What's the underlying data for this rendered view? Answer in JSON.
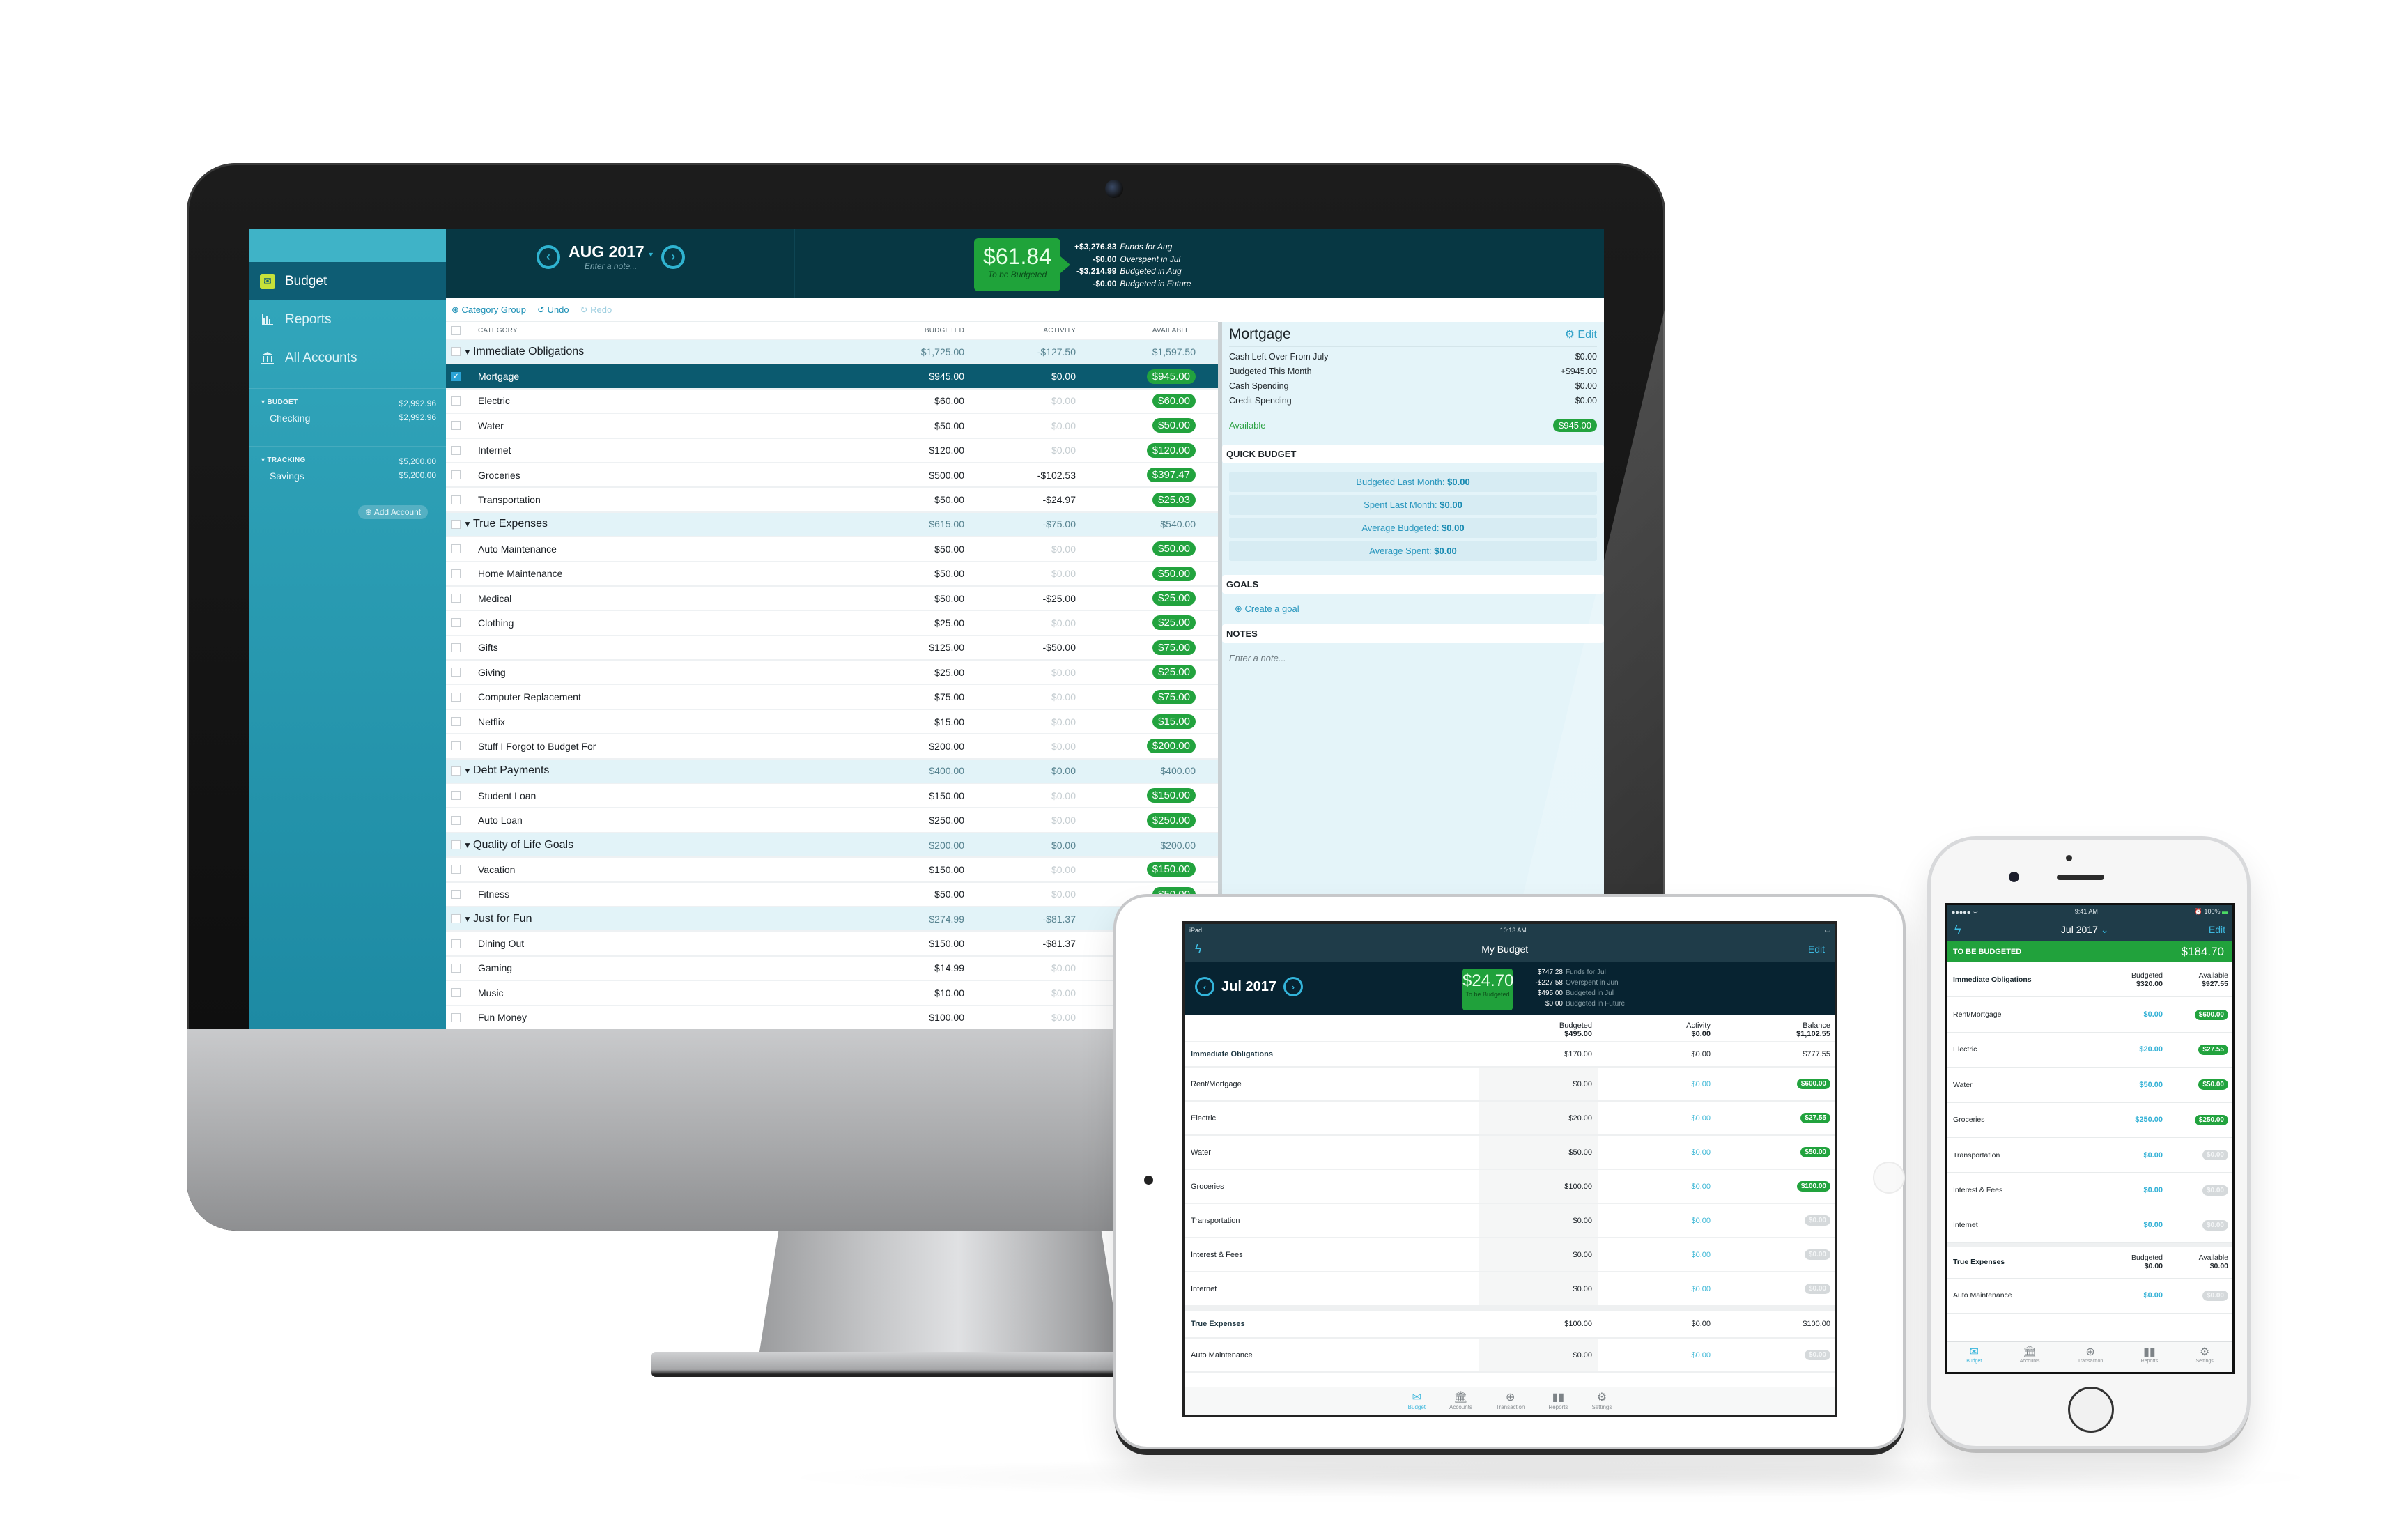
{
  "desktop": {
    "sidebar": {
      "nav": [
        {
          "label": "Budget",
          "icon": "envelope-icon",
          "active": true
        },
        {
          "label": "Reports",
          "icon": "bar-chart-icon",
          "active": false
        },
        {
          "label": "All Accounts",
          "icon": "bank-icon",
          "active": false
        }
      ],
      "account_groups": [
        {
          "name": "BUDGET",
          "total": "$2,992.96",
          "accounts": [
            {
              "name": "Checking",
              "balance": "$2,992.96"
            }
          ]
        },
        {
          "name": "TRACKING",
          "total": "$5,200.00",
          "accounts": [
            {
              "name": "Savings",
              "balance": "$5,200.00"
            }
          ]
        }
      ],
      "add_account_label": "Add Account"
    },
    "header": {
      "month": "AUG 2017",
      "note_placeholder": "Enter a note...",
      "to_be_budgeted": {
        "amount": "$61.84",
        "label": "To be Budgeted"
      },
      "funds_breakdown": [
        {
          "amount": "+$3,276.83",
          "label": "Funds for Aug"
        },
        {
          "amount": "-$0.00",
          "label": "Overspent in Jul"
        },
        {
          "amount": "-$3,214.99",
          "label": "Budgeted in Aug"
        },
        {
          "amount": "-$0.00",
          "label": "Budgeted in Future"
        }
      ]
    },
    "toolbar": {
      "category_group": "Category Group",
      "undo": "Undo",
      "redo": "Redo"
    },
    "table": {
      "columns": [
        "CATEGORY",
        "BUDGETED",
        "ACTIVITY",
        "AVAILABLE"
      ],
      "rows": [
        {
          "type": "group",
          "name": "Immediate Obligations",
          "budgeted": "$1,725.00",
          "activity": "-$127.50",
          "available": "$1,597.50"
        },
        {
          "type": "item",
          "name": "Mortgage",
          "budgeted": "$945.00",
          "activity": "$0.00",
          "available": "$945.00",
          "selected": true
        },
        {
          "type": "item",
          "name": "Electric",
          "budgeted": "$60.00",
          "activity": "$0.00",
          "available": "$60.00"
        },
        {
          "type": "item",
          "name": "Water",
          "budgeted": "$50.00",
          "activity": "$0.00",
          "available": "$50.00"
        },
        {
          "type": "item",
          "name": "Internet",
          "budgeted": "$120.00",
          "activity": "$0.00",
          "available": "$120.00"
        },
        {
          "type": "item",
          "name": "Groceries",
          "budgeted": "$500.00",
          "activity": "-$102.53",
          "available": "$397.47"
        },
        {
          "type": "item",
          "name": "Transportation",
          "budgeted": "$50.00",
          "activity": "-$24.97",
          "available": "$25.03"
        },
        {
          "type": "group",
          "name": "True Expenses",
          "budgeted": "$615.00",
          "activity": "-$75.00",
          "available": "$540.00"
        },
        {
          "type": "item",
          "name": "Auto Maintenance",
          "budgeted": "$50.00",
          "activity": "$0.00",
          "available": "$50.00"
        },
        {
          "type": "item",
          "name": "Home Maintenance",
          "budgeted": "$50.00",
          "activity": "$0.00",
          "available": "$50.00"
        },
        {
          "type": "item",
          "name": "Medical",
          "budgeted": "$50.00",
          "activity": "-$25.00",
          "available": "$25.00"
        },
        {
          "type": "item",
          "name": "Clothing",
          "budgeted": "$25.00",
          "activity": "$0.00",
          "available": "$25.00"
        },
        {
          "type": "item",
          "name": "Gifts",
          "budgeted": "$125.00",
          "activity": "-$50.00",
          "available": "$75.00"
        },
        {
          "type": "item",
          "name": "Giving",
          "budgeted": "$25.00",
          "activity": "$0.00",
          "available": "$25.00"
        },
        {
          "type": "item",
          "name": "Computer Replacement",
          "budgeted": "$75.00",
          "activity": "$0.00",
          "available": "$75.00"
        },
        {
          "type": "item",
          "name": "Netflix",
          "budgeted": "$15.00",
          "activity": "$0.00",
          "available": "$15.00"
        },
        {
          "type": "item",
          "name": "Stuff I Forgot to Budget For",
          "budgeted": "$200.00",
          "activity": "$0.00",
          "available": "$200.00"
        },
        {
          "type": "group",
          "name": "Debt Payments",
          "budgeted": "$400.00",
          "activity": "$0.00",
          "available": "$400.00"
        },
        {
          "type": "item",
          "name": "Student Loan",
          "budgeted": "$150.00",
          "activity": "$0.00",
          "available": "$150.00"
        },
        {
          "type": "item",
          "name": "Auto Loan",
          "budgeted": "$250.00",
          "activity": "$0.00",
          "available": "$250.00"
        },
        {
          "type": "group",
          "name": "Quality of Life Goals",
          "budgeted": "$200.00",
          "activity": "$0.00",
          "available": "$200.00"
        },
        {
          "type": "item",
          "name": "Vacation",
          "budgeted": "$150.00",
          "activity": "$0.00",
          "available": "$150.00"
        },
        {
          "type": "item",
          "name": "Fitness",
          "budgeted": "$50.00",
          "activity": "$0.00",
          "available": "$50.00"
        },
        {
          "type": "group",
          "name": "Just for Fun",
          "budgeted": "$274.99",
          "activity": "-$81.37",
          "available": ""
        },
        {
          "type": "item",
          "name": "Dining Out",
          "budgeted": "$150.00",
          "activity": "-$81.37",
          "available": ""
        },
        {
          "type": "item",
          "name": "Gaming",
          "budgeted": "$14.99",
          "activity": "$0.00",
          "available": ""
        },
        {
          "type": "item",
          "name": "Music",
          "budgeted": "$10.00",
          "activity": "$0.00",
          "available": ""
        },
        {
          "type": "item",
          "name": "Fun Money",
          "budgeted": "$100.00",
          "activity": "$0.00",
          "available": ""
        }
      ]
    },
    "inspector": {
      "title": "Mortgage",
      "edit_label": "Edit",
      "details": [
        {
          "label": "Cash Left Over From July",
          "value": "$0.00"
        },
        {
          "label": "Budgeted This Month",
          "value": "+$945.00"
        },
        {
          "label": "Cash Spending",
          "value": "$0.00"
        },
        {
          "label": "Credit Spending",
          "value": "$0.00"
        }
      ],
      "available_label": "Available",
      "available_value": "$945.00",
      "quick_budget_title": "QUICK BUDGET",
      "quick_budget": [
        {
          "label": "Budgeted Last Month:",
          "value": "$0.00"
        },
        {
          "label": "Spent Last Month:",
          "value": "$0.00"
        },
        {
          "label": "Average Budgeted:",
          "value": "$0.00"
        },
        {
          "label": "Average Spent:",
          "value": "$0.00"
        }
      ],
      "goals_title": "GOALS",
      "create_goal_label": "Create a goal",
      "notes_title": "NOTES",
      "notes_placeholder": "Enter a note..."
    }
  },
  "tablet": {
    "status": {
      "device": "iPad",
      "time": "10:13 AM"
    },
    "nav_title": "My Budget",
    "edit_label": "Edit",
    "month": "Jul 2017",
    "to_be_budgeted": {
      "amount": "$24.70",
      "label": "To be Budgeted"
    },
    "funds_breakdown": [
      {
        "amount": "$747.28",
        "label": "Funds for Jul"
      },
      {
        "amount": "-$227.58",
        "label": "Overspent in Jun"
      },
      {
        "amount": "$495.00",
        "label": "Budgeted in Jul"
      },
      {
        "amount": "$0.00",
        "label": "Budgeted in Future"
      }
    ],
    "totals": {
      "budgeted_label": "Budgeted",
      "budgeted": "$495.00",
      "activity_label": "Activity",
      "activity": "$0.00",
      "balance_label": "Balance",
      "balance": "$1,102.55"
    },
    "rows": [
      {
        "type": "group",
        "name": "Immediate Obligations",
        "budgeted": "$170.00",
        "activity": "$0.00",
        "balance": "$777.55"
      },
      {
        "type": "item",
        "name": "Rent/Mortgage",
        "budgeted": "$0.00",
        "activity": "$0.00",
        "balance": "$600.00",
        "status": "positive"
      },
      {
        "type": "item",
        "name": "Electric",
        "budgeted": "$20.00",
        "activity": "$0.00",
        "balance": "$27.55",
        "status": "positive"
      },
      {
        "type": "item",
        "name": "Water",
        "budgeted": "$50.00",
        "activity": "$0.00",
        "balance": "$50.00",
        "status": "positive"
      },
      {
        "type": "item",
        "name": "Groceries",
        "budgeted": "$100.00",
        "activity": "$0.00",
        "balance": "$100.00",
        "status": "positive"
      },
      {
        "type": "item",
        "name": "Transportation",
        "budgeted": "$0.00",
        "activity": "$0.00",
        "balance": "$0.00",
        "status": "zero"
      },
      {
        "type": "item",
        "name": "Interest & Fees",
        "budgeted": "$0.00",
        "activity": "$0.00",
        "balance": "$0.00",
        "status": "zero"
      },
      {
        "type": "item",
        "name": "Internet",
        "budgeted": "$0.00",
        "activity": "$0.00",
        "balance": "$0.00",
        "status": "zero"
      },
      {
        "type": "group",
        "name": "True Expenses",
        "budgeted": "$100.00",
        "activity": "$0.00",
        "balance": "$100.00"
      },
      {
        "type": "item",
        "name": "Auto Maintenance",
        "budgeted": "$0.00",
        "activity": "$0.00",
        "balance": "$0.00",
        "status": "zero"
      }
    ],
    "tabs": [
      {
        "label": "Budget",
        "icon": "envelope-icon",
        "active": true
      },
      {
        "label": "Accounts",
        "icon": "bank-icon",
        "active": false
      },
      {
        "label": "Transaction",
        "icon": "plus-circle-icon",
        "active": false
      },
      {
        "label": "Reports",
        "icon": "bar-chart-icon",
        "active": false
      },
      {
        "label": "Settings",
        "icon": "gear-icon",
        "active": false
      }
    ]
  },
  "phone": {
    "status": {
      "time": "9:41 AM",
      "battery": "100%"
    },
    "month": "Jul 2017",
    "edit_label": "Edit",
    "to_be_budgeted_label": "TO BE BUDGETED",
    "to_be_budgeted": "$184.70",
    "rows": [
      {
        "type": "group",
        "name": "Immediate Obligations",
        "budgeted_label": "Budgeted",
        "budgeted": "$320.00",
        "available_label": "Available",
        "available": "$927.55"
      },
      {
        "type": "item",
        "name": "Rent/Mortgage",
        "budgeted": "$0.00",
        "available": "$600.00",
        "status": "positive"
      },
      {
        "type": "item",
        "name": "Electric",
        "budgeted": "$20.00",
        "available": "$27.55",
        "status": "positive"
      },
      {
        "type": "item",
        "name": "Water",
        "budgeted": "$50.00",
        "available": "$50.00",
        "status": "positive"
      },
      {
        "type": "item",
        "name": "Groceries",
        "budgeted": "$250.00",
        "available": "$250.00",
        "status": "positive"
      },
      {
        "type": "item",
        "name": "Transportation",
        "budgeted": "$0.00",
        "available": "$0.00",
        "status": "zero"
      },
      {
        "type": "item",
        "name": "Interest & Fees",
        "budgeted": "$0.00",
        "available": "$0.00",
        "status": "zero"
      },
      {
        "type": "item",
        "name": "Internet",
        "budgeted": "$0.00",
        "available": "$0.00",
        "status": "zero"
      },
      {
        "type": "group",
        "name": "True Expenses",
        "budgeted_label": "Budgeted",
        "budgeted": "$0.00",
        "available_label": "Available",
        "available": "$0.00"
      },
      {
        "type": "item",
        "name": "Auto Maintenance",
        "budgeted": "$0.00",
        "available": "$0.00",
        "status": "zero"
      }
    ],
    "tabs": [
      {
        "label": "Budget",
        "icon": "envelope-icon",
        "active": true
      },
      {
        "label": "Accounts",
        "icon": "bank-icon",
        "active": false
      },
      {
        "label": "Transaction",
        "icon": "plus-circle-icon",
        "active": false
      },
      {
        "label": "Reports",
        "icon": "bar-chart-icon",
        "active": false
      },
      {
        "label": "Settings",
        "icon": "gear-icon",
        "active": false
      }
    ]
  },
  "colors": {
    "accent_teal": "#2fb3d0",
    "header_dark": "#073743",
    "sidebar_teal": "#33a8bd",
    "selected_row": "#0b5a6f",
    "positive_green": "#22a33e",
    "zero_grey": "#d5d9db"
  }
}
